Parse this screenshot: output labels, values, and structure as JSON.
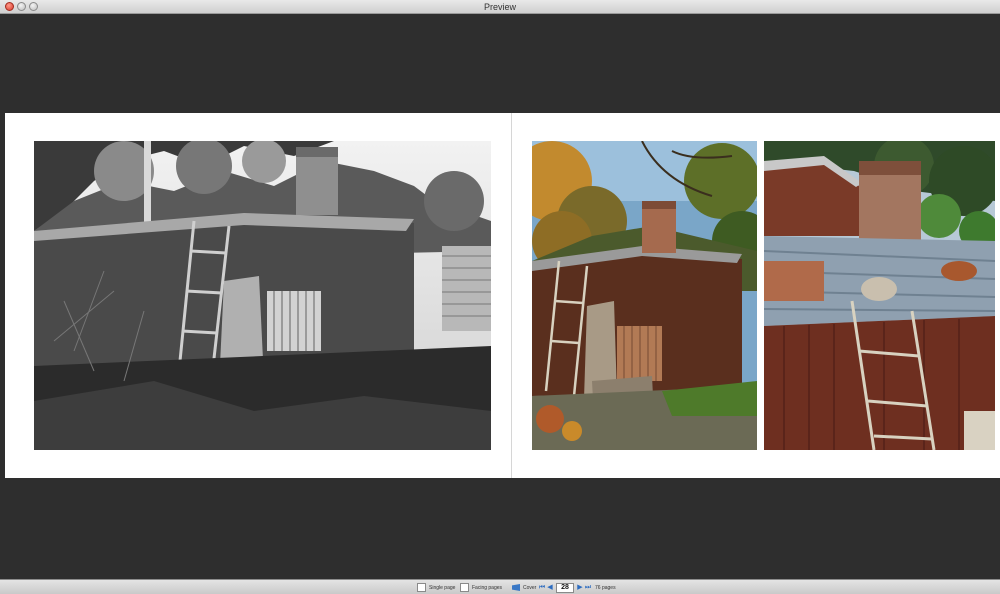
{
  "window": {
    "title": "Preview"
  },
  "toolbar": {
    "single_label": "Single page",
    "facing_label": "Facing pages",
    "cover_label": "Cover",
    "current_page": "28",
    "total_pages": "76 pages"
  },
  "colors": {
    "background": "#2e2e2e",
    "page": "#ffffff",
    "accent": "#3a78c6"
  }
}
